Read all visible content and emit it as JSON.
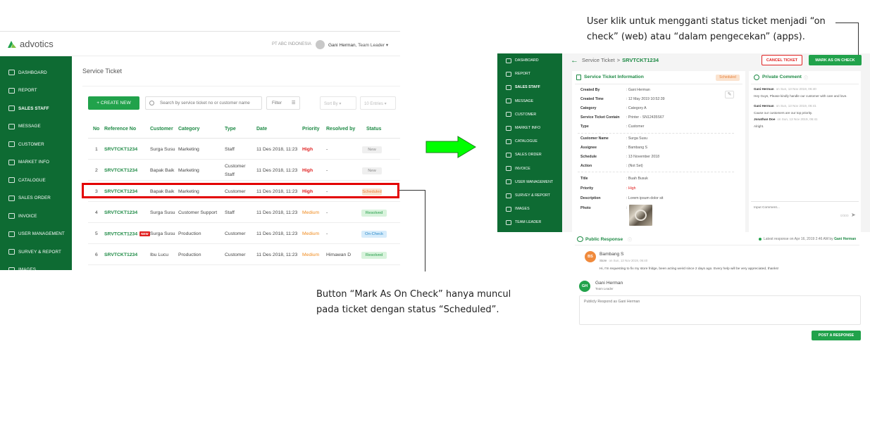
{
  "annotations": {
    "top_line1": "User klik untuk mengganti status ticket menjadi “on",
    "top_line2": "check” (web) atau “dalam pengecekan” (apps).",
    "bottom_line1": "Button “Mark As On Check” hanya muncul",
    "bottom_line2": "pada ticket dengan status “Scheduled”."
  },
  "left_app": {
    "brand": "advotics",
    "company": "PT ABC INDONESIA",
    "user_name": "Gani Herman",
    "user_role": ", Team Leader",
    "sidebar": [
      "DASHBOARD",
      "REPORT",
      "SALES STAFF",
      "MESSAGE",
      "CUSTOMER",
      "MARKET INFO",
      "CATALOGUE",
      "SALES ORDER",
      "INVOICE",
      "USER MANAGEMENT",
      "SURVEY & REPORT",
      "IMAGES"
    ],
    "page_title": "Service Ticket",
    "create_label": "+ CREATE NEW",
    "search_placeholder": "Search by service ticket no or customer name",
    "filter_label": "Filter",
    "sort_label": "Sort By",
    "entries_label": "10 Entries",
    "columns": {
      "no": "No",
      "ref": "Reference No",
      "customer": "Customer",
      "category": "Category",
      "type": "Type",
      "date": "Date",
      "priority": "Priority",
      "resolved": "Resolved by",
      "status": "Status"
    },
    "rows": [
      {
        "no": "1",
        "ref": "SRVTCKT1234",
        "customer": "Surga Susu",
        "category": "Marketing",
        "type": "Staff",
        "date": "11 Des 2018, 11:23",
        "priority": "High",
        "resolved": "-",
        "status": "New"
      },
      {
        "no": "2",
        "ref": "SRVTCKT1234",
        "customer": "Bapak Baik",
        "category": "Marketing",
        "type": "Customer Staff",
        "date": "11 Des 2018, 11:23",
        "priority": "High",
        "resolved": "-",
        "status": "New"
      },
      {
        "no": "3",
        "ref": "SRVTCKT1234",
        "customer": "Bapak Baik",
        "category": "Marketing",
        "type": "Customer",
        "date": "11 Des 2018, 11:23",
        "priority": "High",
        "resolved": "-",
        "status": "Scheduled"
      },
      {
        "no": "4",
        "ref": "SRVTCKT1234",
        "customer": "Surga Susu",
        "category": "Customer Support",
        "type": "Staff",
        "date": "11 Des 2018, 11:23",
        "priority": "Medium",
        "resolved": "-",
        "status": "Resolved"
      },
      {
        "no": "5",
        "ref": "SRVTCKT1234",
        "tag": "NEW",
        "customer": "Surga Susu",
        "category": "Production",
        "type": "Customer",
        "date": "11 Des 2018, 11:23",
        "priority": "Medium",
        "resolved": "-",
        "status": "On-Check"
      },
      {
        "no": "6",
        "ref": "SRVTCKT1234",
        "customer": "Ibu Lucu",
        "category": "Production",
        "type": "Customer",
        "date": "11 Des 2018, 11:23",
        "priority": "Medium",
        "resolved": "Himawan D",
        "status": "Resolved"
      }
    ]
  },
  "right_app": {
    "sidebar": [
      "DASHBOARD",
      "REPORT",
      "SALES STAFF",
      "MESSAGE",
      "CUSTOMER",
      "MARKET INFO",
      "CATALOGUE",
      "SALES ORDER",
      "INVOICE",
      "USER MANAGEMENT",
      "SURVEY & REPORT",
      "IMAGES",
      "TEAM LEADER"
    ],
    "breadcrumb_root": "Service Ticket",
    "breadcrumb_sep": ">",
    "breadcrumb_code": "SRVTCKT1234",
    "cancel_label": "CANCEL TICKET",
    "mark_label": "MARK AS ON CHECK",
    "info_title": "Service Ticket Information",
    "info_status": "Scheduled",
    "fields": [
      {
        "k": "Created By",
        "v": ": Gani Herman"
      },
      {
        "k": "Created Time",
        "v": ": 12 May 2019 10:52:39"
      },
      {
        "k": "Category",
        "v": ": Category A"
      },
      {
        "k": "Service Ticket Contain",
        "v": ": Printer - SN12435S67"
      },
      {
        "k": "Type",
        "v": ": Customer"
      },
      {
        "k": "Customer Name",
        "v": ": Surga Susu"
      },
      {
        "k": "Assignee",
        "v": ": Bambang S"
      },
      {
        "k": "Schedule",
        "v": ": 13 November 2018"
      },
      {
        "k": "Action",
        "v": ": (Not Set)"
      },
      {
        "k": "Title",
        "v": ": Buah Busuk"
      },
      {
        "k": "Priority",
        "v": ": High"
      },
      {
        "k": "Description",
        "v": ": Lorem ipsum dolor sit"
      },
      {
        "k": "Photo",
        "v": ":"
      }
    ],
    "private_comment_title": "Private Comment",
    "comments": [
      {
        "name": "Gani Herman",
        "when": "on Sun, 13 Nov 2019, 06:40",
        "text": "Hey Guys, Please kindly handle our customer with care and love."
      },
      {
        "name": "Gani Herman",
        "when": "on Sun, 13 Nov 2019, 06:41",
        "text": "Cause our customers are our top priority."
      },
      {
        "name": "Jonathan Doe",
        "when": "on Sun, 13 Nov 2019, 06:41",
        "text": "Alright."
      }
    ],
    "comment_placeholder": "Input Comment...",
    "comment_count": "0/300",
    "public_title": "Public Response",
    "latest_prefix": "Latest response on Apr 16, 2019 2:46 AM by",
    "latest_by": "Gani Herman",
    "bs_initials": "BS",
    "bs_name": "Bambang S",
    "bs_role": "Store",
    "bs_when": "on Sun, 13 Nov 2019, 06:40",
    "bs_text": "Hi, I'm requesting to fix my store fridge, been acting weird since 2 days ago. Every help will be very appreciated, thanks!",
    "gh_initials": "GH",
    "gh_name": "Gani Herman",
    "gh_role": "Team Leader",
    "respond_placeholder": "Publicly Respond as Gani Herman",
    "post_label": "POST A RESPONSE"
  }
}
